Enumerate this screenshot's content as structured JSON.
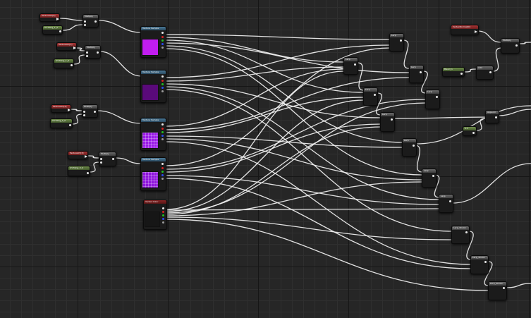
{
  "colors": {
    "background": "#262626",
    "wire": "#f2f2f2",
    "param_header": "#a83434",
    "scalar_header": "#6e8c4a",
    "math_header": "#6b6b6b",
    "texture_header": "#4a7896",
    "preview_1": "#c21df0",
    "preview_2": "#5a0a7a",
    "preview_3": "#9a1ae6",
    "preview_4": "#8f14dc",
    "preview_5": "#161616"
  },
  "nodes": {
    "param_1": "TextureUV[0]",
    "scalar_1": "UVTiling_1_0",
    "multiply_1": "Multiply",
    "texture_1": "Texture Sample",
    "param_2": "TextureUV[1]",
    "scalar_2": "UVTiling_1_0",
    "multiply_2": "Multiply",
    "texture_2": "Texture Sample",
    "param_3": "TextureUV[2]",
    "scalar_3": "UVTiling_2_0",
    "multiply_3": "Multiply",
    "texture_3": "Texture Sample",
    "param_4": "TextureUV[3]",
    "scalar_4": "UVTiling_3_0",
    "multiply_4": "Multiply",
    "texture_4": "Texture Sample",
    "vertex_color": "Vertex Color",
    "lerp_top": "Lerp",
    "lerp_2": "Lerp",
    "lerp_3": "Lerp",
    "lerp_4": "Lerp",
    "lerp_5": "Lerp",
    "lerp_6": "Lerp",
    "lerp_7": "Lerp",
    "lerp_8": "Lerp",
    "lerp_9": "Lerp",
    "lerp_bot_1": "Lerp_3Color",
    "lerp_bot_2": "Lerp_3Color",
    "lerp_bot_3": "Lerp_3Color",
    "param_top_right": "VertexNormal[0]",
    "scalar_right": "Blend_1",
    "multiply_right": "Multiply",
    "add_right": "Add",
    "append_right": "Append",
    "scalar_small": "0.5"
  }
}
